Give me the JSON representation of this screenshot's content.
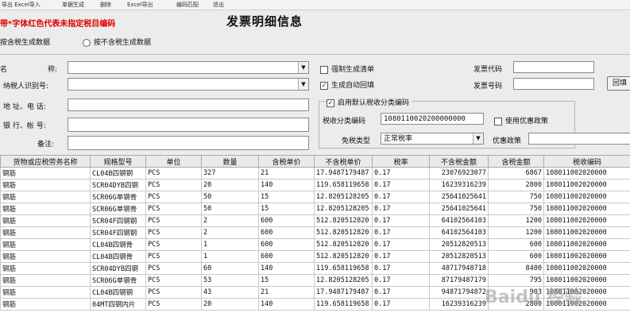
{
  "menu": [
    {
      "label": "导出 Excel导入"
    },
    {
      "label": "单据生成"
    },
    {
      "label": "删除"
    },
    {
      "label": "Excel导出"
    },
    {
      "label": "编码匹配"
    },
    {
      "label": "退出"
    }
  ],
  "header": {
    "red_note": "带*字体红色代表未指定税目编码",
    "title": "发票明细信息"
  },
  "radios": {
    "incl_tax": "按含税生成数据",
    "excl_tax": "按不含税生成数据",
    "selected": "incl_tax"
  },
  "form": {
    "name_label": "名　　称:",
    "name_value": "",
    "taxid_label": "纳税人识别号:",
    "taxid_value": "",
    "address_label": "地 址、电 话:",
    "address_value": "",
    "bank_label": "银 行、帐 号:",
    "bank_value": "",
    "remark_label": "备注:",
    "remark_value": ""
  },
  "options": {
    "force_list_label": "强制生成清单",
    "force_list_checked": false,
    "auto_return_label": "生成自动回填",
    "auto_return_checked": true,
    "invoice_code_label": "发票代码",
    "invoice_code_value": "",
    "invoice_no_label": "发票号码",
    "invoice_no_value": "",
    "return_button": "回填"
  },
  "taxcode_group": {
    "enable_default_label": "启用默认税收分类编码",
    "enable_default_checked": true,
    "code_label": "税收分类编码",
    "code_value": "1080110020200000000",
    "preferential_label": "使用优惠政策",
    "preferential_checked": false,
    "exempt_type_label": "免税类型",
    "exempt_type_value": "正常税率",
    "preferential_policy_label": "优惠政策",
    "preferential_policy_value": ""
  },
  "table": {
    "columns": [
      "货物或应税劳务名称",
      "规格型号",
      "单位",
      "数量",
      "含税单价",
      "不含税单价",
      "税率",
      "不含税金额",
      "含税金额",
      "税收编码"
    ],
    "rows": [
      [
        "钢筋",
        "CL04B四钢钢",
        "PCS",
        "327",
        "21",
        "17.9487179487",
        "0.17",
        "23076923077",
        "6867",
        "108011002020000"
      ],
      [
        "钢筋",
        "SCR04DYB四钢",
        "PCS",
        "20",
        "140",
        "119.658119658",
        "0.17",
        "16239316239",
        "2800",
        "108011002020000"
      ],
      [
        "钢筋",
        "SCR06G单钢骨",
        "PCS",
        "50",
        "15",
        "12.8205128205",
        "0.17",
        "25641025641",
        "750",
        "108011002020000"
      ],
      [
        "钢筋",
        "SCR06G单钢骨",
        "PCS",
        "50",
        "15",
        "12.8205128205",
        "0.17",
        "25641025641",
        "750",
        "108011002020000"
      ],
      [
        "钢筋",
        "SCR04F四钢钢",
        "PCS",
        "2",
        "600",
        "512.820512820",
        "0.17",
        "64102564103",
        "1200",
        "108011002020000"
      ],
      [
        "钢筋",
        "SCR04F四钢钢",
        "PCS",
        "2",
        "600",
        "512.820512820",
        "0.17",
        "64102564103",
        "1200",
        "108011002020000"
      ],
      [
        "钢筋",
        "CL04B四钢骨",
        "PCS",
        "1",
        "600",
        "512.820512820",
        "0.17",
        "20512820513",
        "600",
        "108011002020000"
      ],
      [
        "钢筋",
        "CL04B四钢骨",
        "PCS",
        "1",
        "600",
        "512.820512820",
        "0.17",
        "20512820513",
        "600",
        "108011002020000"
      ],
      [
        "钢筋",
        "SCR04DYB四钢",
        "PCS",
        "60",
        "140",
        "119.658119658",
        "0.17",
        "48717948718",
        "8400",
        "108011002020000"
      ],
      [
        "钢筋",
        "SCR06G单钢骨",
        "PCS",
        "53",
        "15",
        "12.8205128205",
        "0.17",
        "87179487179",
        "795",
        "108011002020000"
      ],
      [
        "钢筋",
        "CL04B四钢钢",
        "PCS",
        "43",
        "21",
        "17.9487179487",
        "0.17",
        "94871794872",
        "903",
        "108011002020000"
      ],
      [
        "钢筋",
        "04MT四钢内片",
        "PCS",
        "20",
        "140",
        "119.658119658",
        "0.17",
        "16239316239",
        "2800",
        "108011002020000"
      ]
    ]
  },
  "watermark": "Baidu 经验"
}
